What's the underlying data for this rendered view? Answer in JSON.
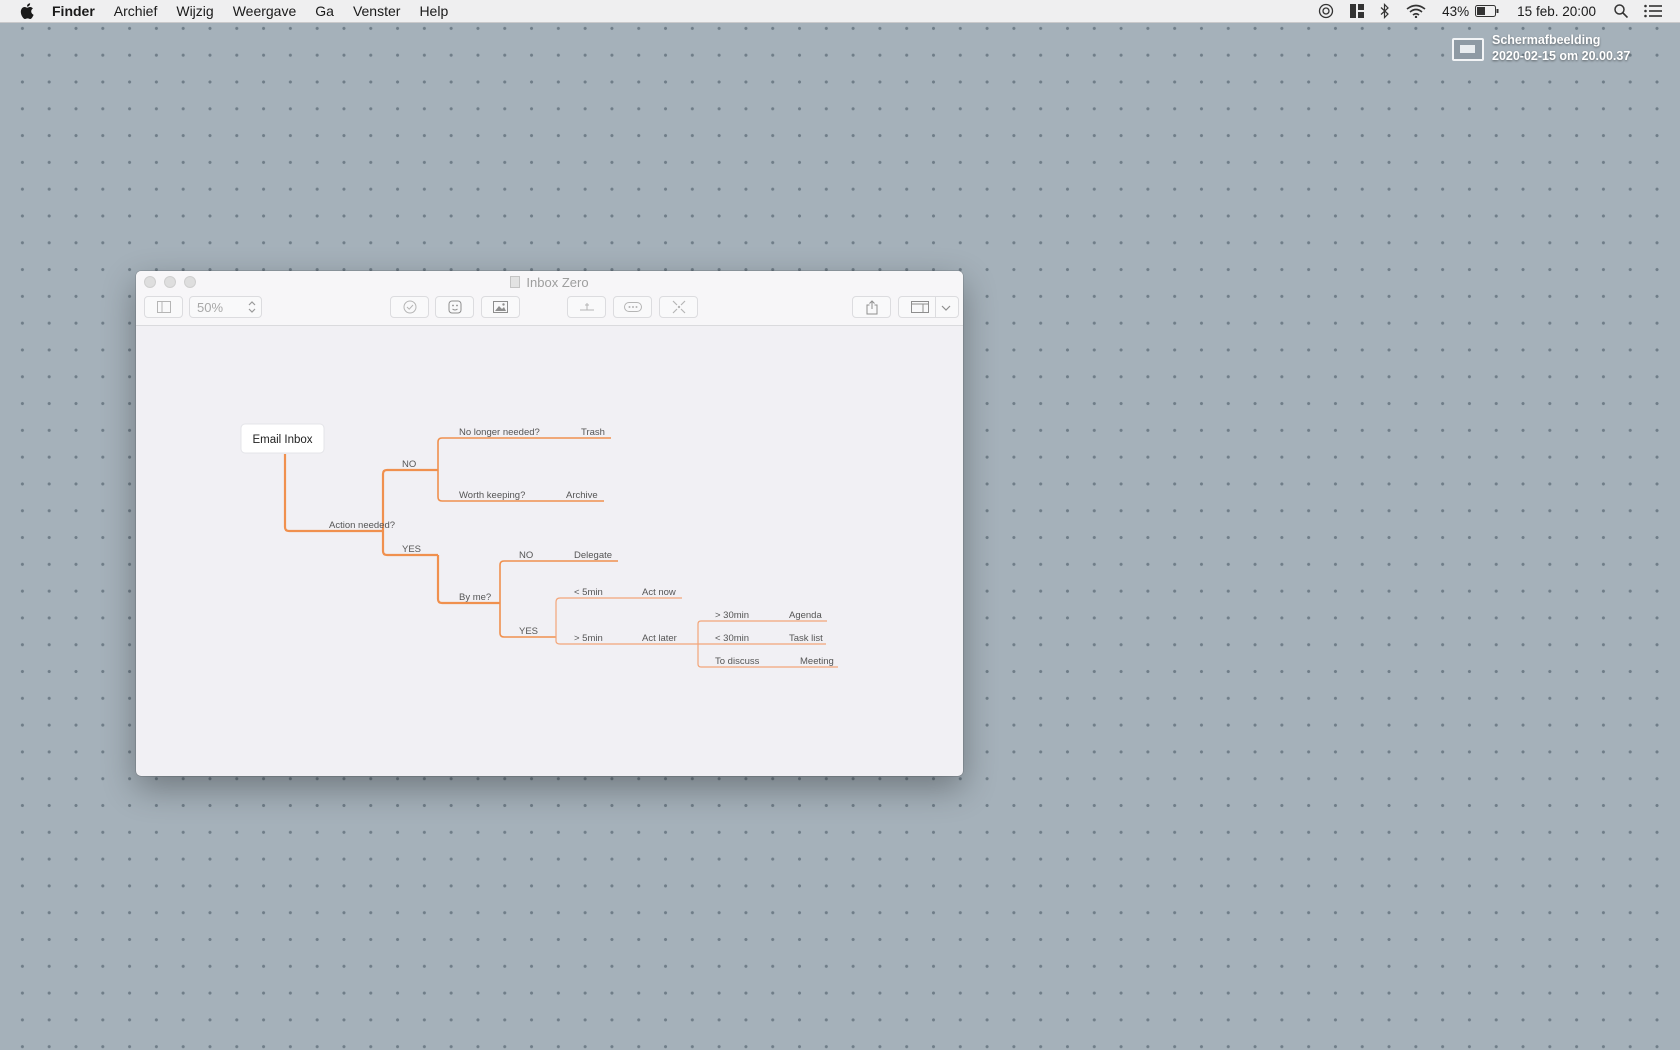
{
  "menubar": {
    "items": [
      "Finder",
      "Archief",
      "Wijzig",
      "Weergave",
      "Ga",
      "Venster",
      "Help"
    ],
    "battery": "43%",
    "clock": "15 feb.  20:00"
  },
  "desktop": {
    "file_name": "Schermafbeelding",
    "file_date": "2020-02-15 om 20.00.37"
  },
  "window": {
    "title": "Inbox Zero",
    "zoom": "50%"
  },
  "mindmap": {
    "root": "Email Inbox",
    "action_needed": "Action needed?",
    "no": "NO",
    "yes": "YES",
    "no_longer_needed": "No longer needed?",
    "trash": "Trash",
    "worth_keeping": "Worth keeping?",
    "archive": "Archive",
    "by_me": "By me?",
    "by_me_no": "NO",
    "delegate": "Delegate",
    "by_me_yes": "YES",
    "lt_5min": "< 5min",
    "act_now": "Act now",
    "gt_5min": "> 5min",
    "act_later": "Act later",
    "gt_30min": "> 30min",
    "agenda": "Agenda",
    "lt_30min": "< 30min",
    "task_list": "Task list",
    "to_discuss": "To discuss",
    "meeting": "Meeting"
  },
  "colors": {
    "branch": "#f0904e",
    "branch_light": "#f3a579"
  }
}
